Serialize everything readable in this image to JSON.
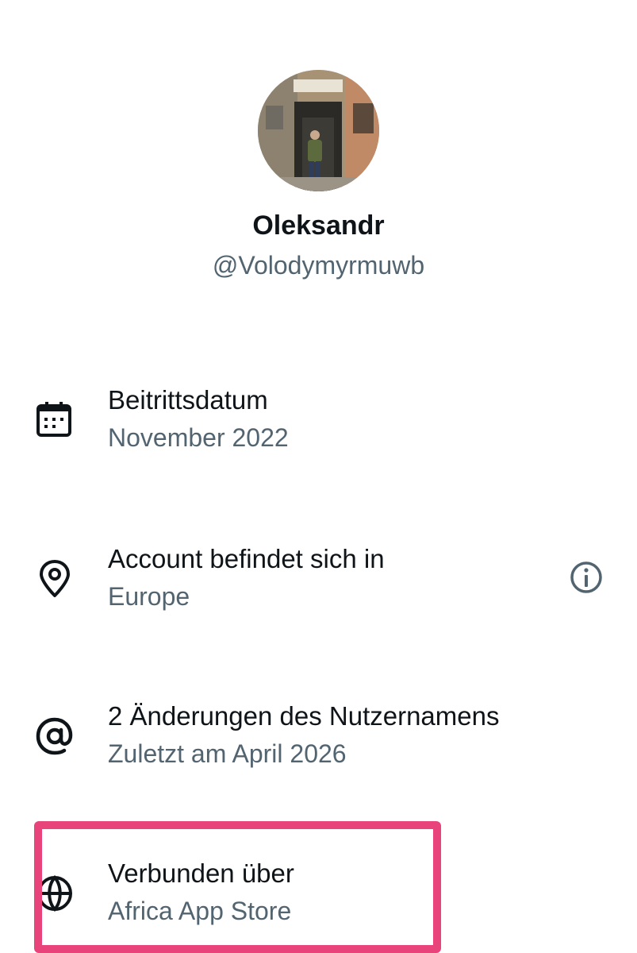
{
  "profile": {
    "display_name": "Oleksandr",
    "handle": "@Volodymyrmuwb",
    "avatar_icon": "profile-photo-alley"
  },
  "details": [
    {
      "icon": "calendar-icon",
      "title": "Beitrittsdatum",
      "subtitle": "November 2022"
    },
    {
      "icon": "location-pin-icon",
      "title": "Account befindet sich in",
      "subtitle": "Europe",
      "info_icon": "info-icon"
    },
    {
      "icon": "at-sign-icon",
      "title": "2 Änderungen des Nutzernamens",
      "subtitle": "Zuletzt am April 2026"
    },
    {
      "icon": "globe-icon",
      "title": "Verbunden über",
      "subtitle": "Africa App Store"
    }
  ],
  "colors": {
    "primary_text": "#0f1419",
    "secondary_text": "#536471",
    "highlight_border": "#e8437b"
  }
}
